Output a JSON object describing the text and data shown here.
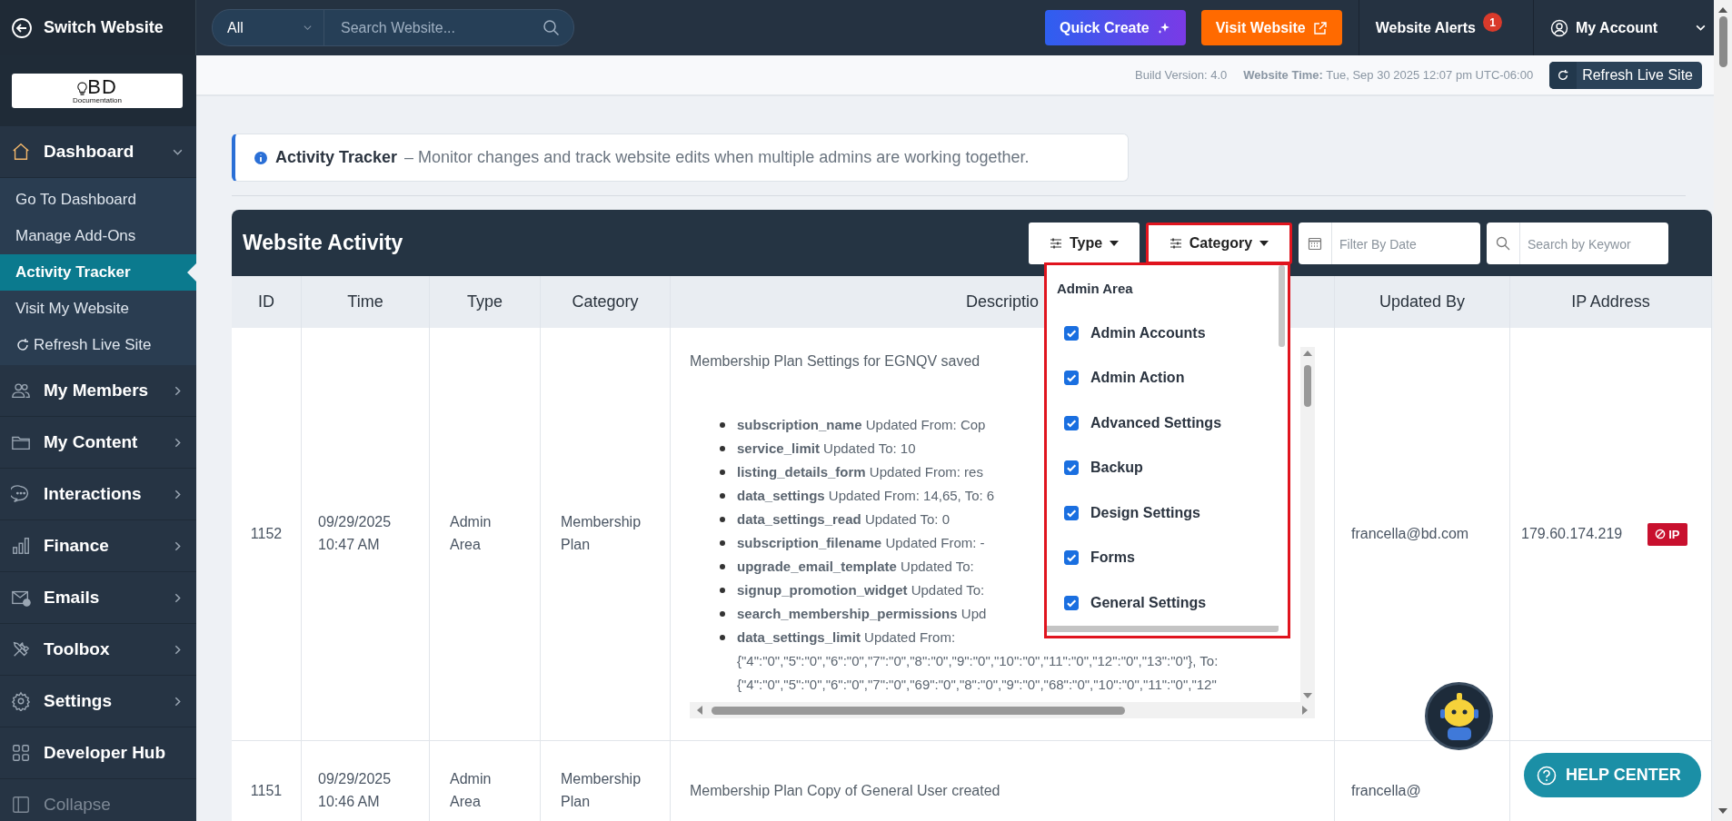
{
  "sidebar": {
    "switch_label": "Switch Website",
    "logo": {
      "mark": "BD",
      "caption": "Documentation"
    },
    "menu": [
      {
        "label": "Dashboard",
        "expanded": true,
        "children": [
          {
            "label": "Go To Dashboard",
            "kind": "link",
            "selected": false
          },
          {
            "label": "Manage Add-Ons",
            "kind": "link",
            "selected": false
          },
          {
            "label": "Activity Tracker",
            "kind": "link",
            "selected": true
          },
          {
            "label": "Visit My Website",
            "kind": "link",
            "selected": false
          },
          {
            "label": "Refresh Live Site",
            "kind": "action",
            "selected": false
          }
        ]
      },
      {
        "label": "My Members",
        "expanded": false
      },
      {
        "label": "My Content",
        "expanded": false
      },
      {
        "label": "Interactions",
        "expanded": false
      },
      {
        "label": "Finance",
        "expanded": false
      },
      {
        "label": "Emails",
        "expanded": false
      },
      {
        "label": "Toolbox",
        "expanded": false
      },
      {
        "label": "Settings",
        "expanded": false
      },
      {
        "label": "Developer Hub"
      }
    ],
    "collapse": "Collapse"
  },
  "topbar": {
    "scope": {
      "value": "All"
    },
    "search": {
      "placeholder": "Search Website..."
    },
    "quick_create": "Quick Create",
    "visit_website": "Visit Website",
    "alerts": {
      "label": "Website Alerts",
      "count": "1"
    },
    "account": "My Account"
  },
  "subbar": {
    "build": "Build Version: 4.0",
    "time": "**Website Time:** Tue, Sep 30 2025 12:07 pm UTC-06:00",
    "refresh": "Refresh Live Site"
  },
  "notice": {
    "title": "Activity Tracker",
    "text": "– Monitor changes and track website edits when multiple admins are working together."
  },
  "activity": {
    "title": "Website Activity",
    "filters": {
      "type": "Type",
      "category": "Category",
      "date": {
        "placeholder": "Filter By Date"
      },
      "keyword": {
        "placeholder": "Search by Keywor"
      }
    },
    "category_menu": {
      "group": "Admin Area",
      "options": [
        {
          "label": "Admin Accounts",
          "checked": true
        },
        {
          "label": "Admin Action",
          "checked": true
        },
        {
          "label": "Advanced Settings",
          "checked": true
        },
        {
          "label": "Backup",
          "checked": true
        },
        {
          "label": "Design Settings",
          "checked": true
        },
        {
          "label": "Forms",
          "checked": true
        },
        {
          "label": "General Settings",
          "checked": true
        }
      ]
    },
    "columns": [
      "ID",
      "Time",
      "Type",
      "Category",
      "Descriptio",
      "Updated By",
      "IP Address"
    ],
    "rows": [
      {
        "id": "1152",
        "time": "09/29/2025 10:47 AM",
        "type": "Admin Area",
        "category": "Membership Plan",
        "description": {
          "summary": "Membership Plan Settings for EGNQV saved",
          "changes": [
            {
              "text": "**subscription_name** Updated From: Cop"
            },
            {
              "text": "**service_limit** Updated To: 10"
            },
            {
              "text": "**listing_details_form** Updated From: res"
            },
            {
              "text": "**data_settings** Updated From: 14,65, To: 6"
            },
            {
              "text": "**data_settings_read** Updated To: 0"
            },
            {
              "text": "**subscription_filename** Updated From: -"
            },
            {
              "text": "**upgrade_email_template** Updated To:"
            },
            {
              "text": "**signup_promotion_widget** Updated To:"
            },
            {
              "text": "**search_membership_permissions** Upd"
            },
            {
              "text": "**data_settings_limit** Updated From:",
              "lines": [
                "{\"4\":\"0\",\"5\":\"0\",\"6\":\"0\",\"7\":\"0\",\"8\":\"0\",\"9\":\"0\",\"10\":\"0\",\"11\":\"0\",\"12\":\"0\",\"13\":\"0\"}, To:",
                "{\"4\":\"0\",\"5\":\"0\",\"6\":\"0\",\"7\":\"0\",\"69\":\"0\",\"8\":\"0\",\"9\":\"0\",\"68\":\"0\",\"10\":\"0\",\"11\":\"0\",\"12\""
              ]
            }
          ]
        },
        "updated_by": "francella@bd.com",
        "ip": "179.60.174.219",
        "ban": "IP"
      },
      {
        "id": "1151",
        "time": "09/29/2025 10:46 AM",
        "type": "Admin Area",
        "category": "Membership Plan",
        "description": {
          "summary": "Membership Plan Copy of General User created"
        },
        "updated_by": "francella@"
      }
    ]
  },
  "help": {
    "label": "HELP CENTER"
  }
}
